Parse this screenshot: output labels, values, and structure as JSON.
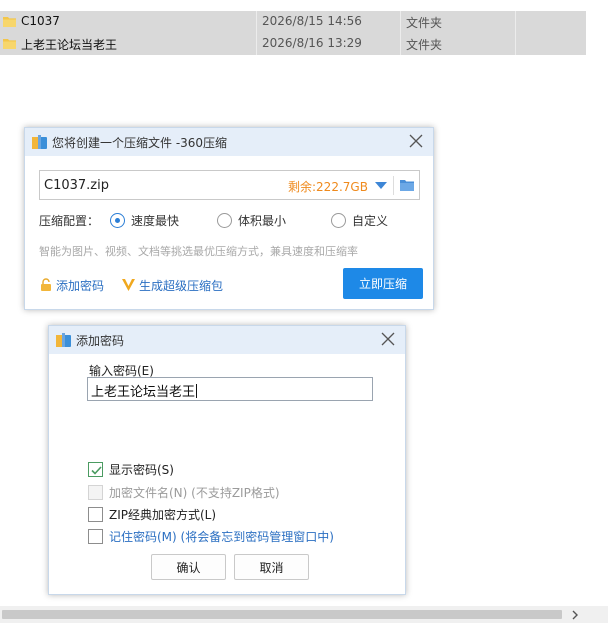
{
  "explorer": {
    "files": [
      {
        "name": "C1037",
        "date": "2026/8/15 14:56",
        "type": "文件夹"
      },
      {
        "name": "上老王论坛当老王",
        "date": "2026/8/16 13:29",
        "type": "文件夹"
      }
    ]
  },
  "compress_dialog": {
    "title": "您将创建一个压缩文件 -360压缩",
    "filename": "C1037.zip",
    "remaining": "剩余:222.7GB",
    "config_label": "压缩配置：",
    "options": [
      {
        "label": "速度最快",
        "selected": true
      },
      {
        "label": "体积最小",
        "selected": false
      },
      {
        "label": "自定义",
        "selected": false
      }
    ],
    "hint": "智能为图片、视频、文档等挑选最优压缩方式，兼具速度和压缩率",
    "add_password_link": "添加密码",
    "super_pack_link": "生成超级压缩包",
    "compress_button": "立即压缩"
  },
  "password_dialog": {
    "title": "添加密码",
    "input_label": "输入密码(E)",
    "password_value": "上老王论坛当老王",
    "checkboxes": [
      {
        "label": "显示密码(S)",
        "checked": true,
        "disabled": false
      },
      {
        "label": "加密文件名(N) (不支持ZIP格式)",
        "checked": false,
        "disabled": true
      },
      {
        "label": "ZIP经典加密方式(L)",
        "checked": false,
        "disabled": false
      },
      {
        "label": "记住密码(M) (将会备忘到密码管理窗口中)",
        "checked": false,
        "disabled": false
      }
    ],
    "ok_button": "确认",
    "cancel_button": "取消"
  },
  "colors": {
    "accent": "#1e89e7",
    "remaining_text": "#ef8a1d",
    "link": "#2b6fc2",
    "title_bar": "#e5eef9",
    "checkmark": "#4b9b61"
  }
}
